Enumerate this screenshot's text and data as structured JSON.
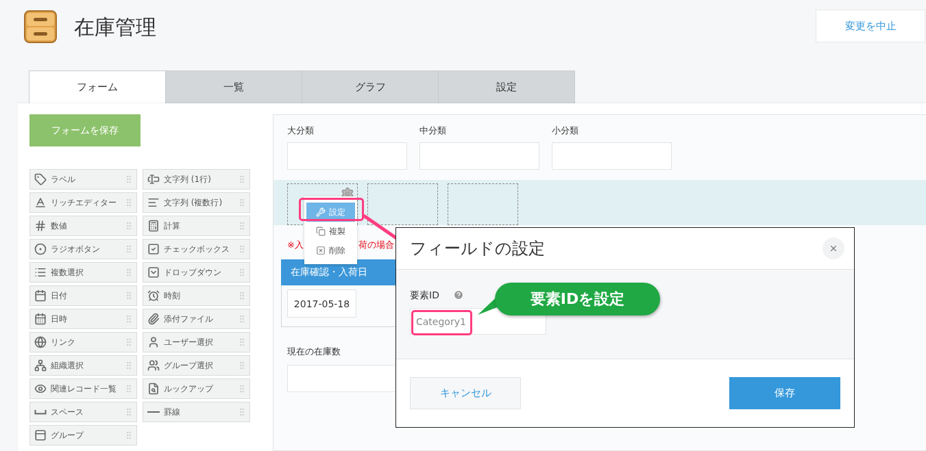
{
  "app": {
    "title": "在庫管理",
    "cancel_button": "変更を中止"
  },
  "tabs": [
    {
      "label": "フォーム",
      "selected": true
    },
    {
      "label": "一覧",
      "selected": false
    },
    {
      "label": "グラフ",
      "selected": false
    },
    {
      "label": "設定",
      "selected": false
    }
  ],
  "save_form_button": "フォームを保存",
  "palette": [
    {
      "label": "ラベル"
    },
    {
      "label": "文字列 (1行)"
    },
    {
      "label": "リッチエディター"
    },
    {
      "label": "文字列 (複数行)"
    },
    {
      "label": "数値"
    },
    {
      "label": "計算"
    },
    {
      "label": "ラジオボタン"
    },
    {
      "label": "チェックボックス"
    },
    {
      "label": "複数選択"
    },
    {
      "label": "ドロップダウン"
    },
    {
      "label": "日付"
    },
    {
      "label": "時刻"
    },
    {
      "label": "日時"
    },
    {
      "label": "添付ファイル"
    },
    {
      "label": "リンク"
    },
    {
      "label": "ユーザー選択"
    },
    {
      "label": "組織選択"
    },
    {
      "label": "グループ選択"
    },
    {
      "label": "関連レコード一覧"
    },
    {
      "label": "ルックアップ"
    },
    {
      "label": "スペース"
    },
    {
      "label": "罫線"
    },
    {
      "label": "グループ"
    }
  ],
  "form": {
    "category_fields": [
      {
        "label": "大分類"
      },
      {
        "label": "中分類"
      },
      {
        "label": "小分類"
      }
    ],
    "note_fragments": [
      "※入",
      "荷の場合"
    ],
    "table": {
      "columns": [
        "在庫確認・入荷日"
      ],
      "rows": [
        [
          "2017-05-18"
        ]
      ]
    },
    "stock_field": {
      "label": "現在の在庫数"
    }
  },
  "context_menu": [
    {
      "label": "設定",
      "selected": true
    },
    {
      "label": "複製",
      "selected": false
    },
    {
      "label": "削除",
      "selected": false
    }
  ],
  "dialog": {
    "title": "フィールドの設定",
    "field_label": "要素ID",
    "field_value": "Category1",
    "buttons": [
      {
        "label": "キャンセル",
        "kind": "secondary"
      },
      {
        "label": "保存",
        "kind": "primary"
      }
    ]
  },
  "callout": "要素IDを設定"
}
